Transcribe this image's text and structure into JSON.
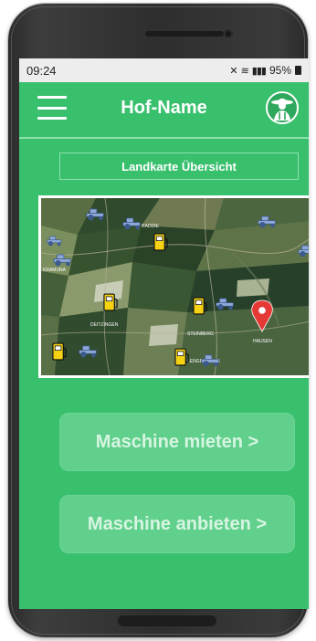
{
  "status_bar": {
    "time": "09:24",
    "battery_percent": "95%"
  },
  "app_bar": {
    "title": "Hof-Name"
  },
  "map": {
    "heading": "Landkarte Übersicht",
    "place_labels": [
      "RADDIE",
      "KRAMUNA",
      "DEITZINGEN",
      "STEINBERG",
      "HAUSEN",
      "LENGFOLDING"
    ],
    "icons": [
      "tractor-icon",
      "fuel-pump-icon",
      "location-pin-icon"
    ]
  },
  "actions": {
    "rent_label": "Maschine mieten >",
    "offer_label": "Maschine anbieten >"
  },
  "colors": {
    "screen_green": "#38c06d",
    "button_green": "#62d08d",
    "fuel_yellow": "#f5d313",
    "tractor_blue": "#8ea8d8",
    "pin_red": "#e53935"
  }
}
